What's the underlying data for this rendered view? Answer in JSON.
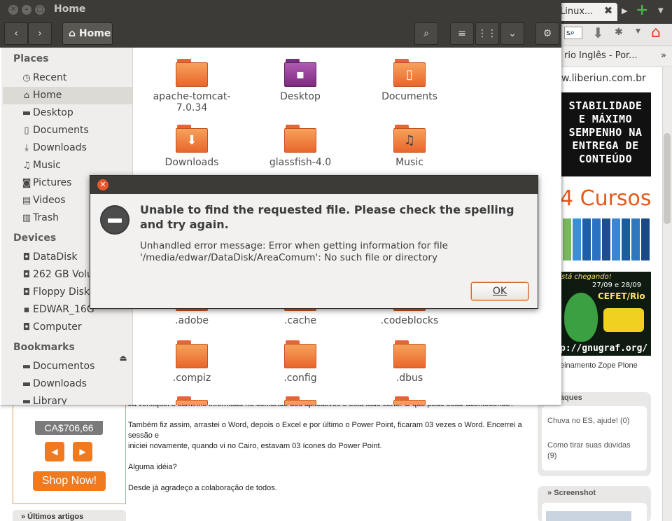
{
  "browser": {
    "tab_title": "Linux...",
    "search_text": "s",
    "bookmark_item": "rio Inglês - Por...",
    "bookmark_more": "»",
    "site_url": "w.liberiun.com.br",
    "banner1_text": "STABILIDADE\nE MÁXIMO\nSEMPENHO NA\nENTREGA DE\nCONTEÚDO",
    "banner2_title": "4 Cursos",
    "banner3_head": "stá chegando!",
    "banner3_date": "27/09 e 28/09",
    "banner3_place": "CEFET/Rio",
    "banner3_url": "p://gnugraf.org/",
    "zope_text": "einamento Zope Plone",
    "sidebar_box1_title": "estaques",
    "sidebar_links": [
      "Chuva no ES, ajude! (0)",
      "Como tirar suas dúvidas (9)"
    ],
    "sidebar_box2_title": "» Screenshot",
    "post_lines": [
      "Já verifiquei o caminho informado no comando dos aplicativos e está tudo certo. O que pode estar acontecendo?",
      "Também fiz assim, arrastei o Word, depois o Excel e por último o Power Point, ficaram 03 vezes o Word. Encerrei a sessão e",
      "iniciei novamente, quando vi no Cairo, estavam 03 ícones do Power Point.",
      "Alguma idéia?",
      "Desde já agradeço a colaboração de todos."
    ],
    "ad_price": "CA$706,66",
    "ad_shop_label": "Shop Now!",
    "latest_title": "» Últimos artigos"
  },
  "nautilus": {
    "window_title": "Home",
    "location_label": "Home",
    "places_header": "Places",
    "places": [
      "Recent",
      "Home",
      "Desktop",
      "Documents",
      "Downloads",
      "Music",
      "Pictures",
      "Videos",
      "Trash"
    ],
    "devices_header": "Devices",
    "devices": [
      "DataDisk",
      "262 GB Volume",
      "Floppy Disk",
      "EDWAR_16G",
      "Computer"
    ],
    "bookmarks_header": "Bookmarks",
    "bookmarks": [
      "Documentos",
      "Downloads",
      "Library"
    ],
    "files_row1": [
      "apache-tomcat-\n7.0.34",
      "Desktop",
      "Documents"
    ],
    "files_row2": [
      "Downloads",
      "glassfish-4.0",
      "Music"
    ],
    "files_row3": [
      ".adobe",
      ".cache",
      ".codeblocks"
    ],
    "files_row4": [
      ".compiz",
      ".config",
      ".dbus"
    ]
  },
  "dialog": {
    "primary_text": "Unable to find the requested file. Please check the spelling and try again.",
    "secondary_text": "Unhandled error message: Error when getting information for file '/media/edwar/DataDisk/AreaComum': No such file or directory",
    "ok_label": "OK"
  },
  "colors": {
    "titlebar": "#3c3b37",
    "folder_orange": "#e9662c",
    "desktop_purple": "#7d2b7f",
    "dialog_close": "#e8562a",
    "shop_orange": "#f07a20"
  }
}
